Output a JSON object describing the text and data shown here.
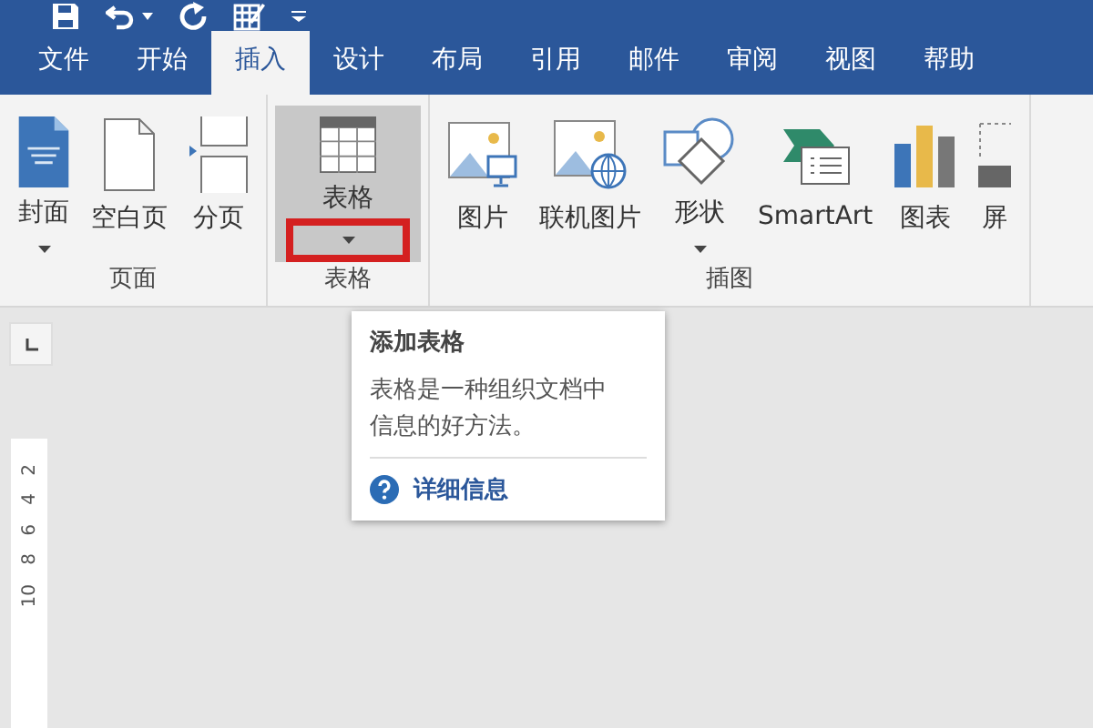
{
  "tabs": [
    {
      "label": "文件",
      "selected": false
    },
    {
      "label": "开始",
      "selected": false
    },
    {
      "label": "插入",
      "selected": true
    },
    {
      "label": "设计",
      "selected": false
    },
    {
      "label": "布局",
      "selected": false
    },
    {
      "label": "引用",
      "selected": false
    },
    {
      "label": "邮件",
      "selected": false
    },
    {
      "label": "审阅",
      "selected": false
    },
    {
      "label": "视图",
      "selected": false
    },
    {
      "label": "帮助",
      "selected": false
    }
  ],
  "groups": [
    {
      "label": "页面",
      "items": [
        {
          "label": "封面",
          "kind": "cover",
          "dropdown": true,
          "selected": false,
          "highlighted": false
        },
        {
          "label": "空白页",
          "kind": "blank",
          "dropdown": false,
          "selected": false,
          "highlighted": false
        },
        {
          "label": "分页",
          "kind": "pagebreak",
          "dropdown": false,
          "selected": false,
          "highlighted": false
        }
      ]
    },
    {
      "label": "表格",
      "items": [
        {
          "label": "表格",
          "kind": "table",
          "dropdown": true,
          "selected": true,
          "highlighted": true
        }
      ]
    },
    {
      "label": "插图",
      "items": [
        {
          "label": "图片",
          "kind": "picture",
          "dropdown": false,
          "selected": false,
          "highlighted": false
        },
        {
          "label": "联机图片",
          "kind": "online-picture",
          "dropdown": false,
          "selected": false,
          "highlighted": false
        },
        {
          "label": "形状",
          "kind": "shapes",
          "dropdown": true,
          "selected": false,
          "highlighted": false
        },
        {
          "label": "SmartArt",
          "kind": "smartart",
          "dropdown": false,
          "selected": false,
          "highlighted": false
        },
        {
          "label": "图表",
          "kind": "chart",
          "dropdown": false,
          "selected": false,
          "highlighted": false
        },
        {
          "label": "屏",
          "kind": "screenshot",
          "dropdown": false,
          "selected": false,
          "highlighted": false
        }
      ]
    }
  ],
  "tooltip": {
    "title": "添加表格",
    "body": "表格是一种组织文档中信息的好方法。",
    "link": "详细信息"
  },
  "ruler": [
    "2",
    "4",
    "6",
    "8",
    "10"
  ]
}
